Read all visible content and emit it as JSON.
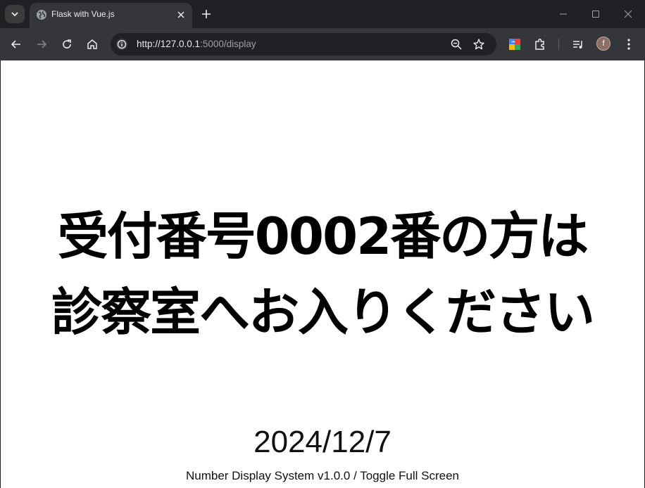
{
  "browser": {
    "tab_title": "Flask with Vue.js",
    "url_host": "http://127.0.0.1",
    "url_rest": ":5000/display",
    "profile_initial": "f"
  },
  "page": {
    "message_line1": "受付番号0002番の方は",
    "message_line2": "診察室へお入りください",
    "date": "2024/12/7",
    "footer_system": "Number Display System v1.0.0",
    "footer_separator": " / ",
    "footer_toggle": "Toggle Full Screen"
  },
  "colors": {
    "chrome_dark": "#202124",
    "chrome_toolbar": "#35363a",
    "page_bg": "#ffffff",
    "text": "#000000"
  }
}
